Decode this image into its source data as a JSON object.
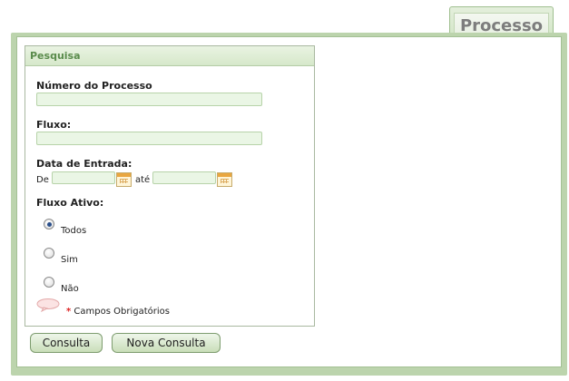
{
  "tab": {
    "label": "Processo"
  },
  "panel": {
    "title": "Pesquisa"
  },
  "form": {
    "numero_label": "Número do Processo",
    "numero_value": "",
    "fluxo_label": "Fluxo:",
    "fluxo_value": "",
    "data_label": "Data de Entrada:",
    "de_label": "De",
    "ate_label": "até",
    "data_de_value": "",
    "data_ate_value": "",
    "fluxo_ativo_label": "Fluxo Ativo:",
    "options": [
      {
        "label": "Todos",
        "selected": true
      },
      {
        "label": "Sim",
        "selected": false
      },
      {
        "label": "Não",
        "selected": false
      }
    ],
    "required_marker": "*",
    "required_text": "Campos Obrigatórios"
  },
  "buttons": {
    "consulta": "Consulta",
    "nova_consulta": "Nova Consulta"
  },
  "colors": {
    "frame": "#bcd4ad",
    "field_bg": "#eaf6e5",
    "header_text": "#5a8b4c"
  },
  "icons": [
    "calendar-icon",
    "speech-bubble-icon"
  ]
}
